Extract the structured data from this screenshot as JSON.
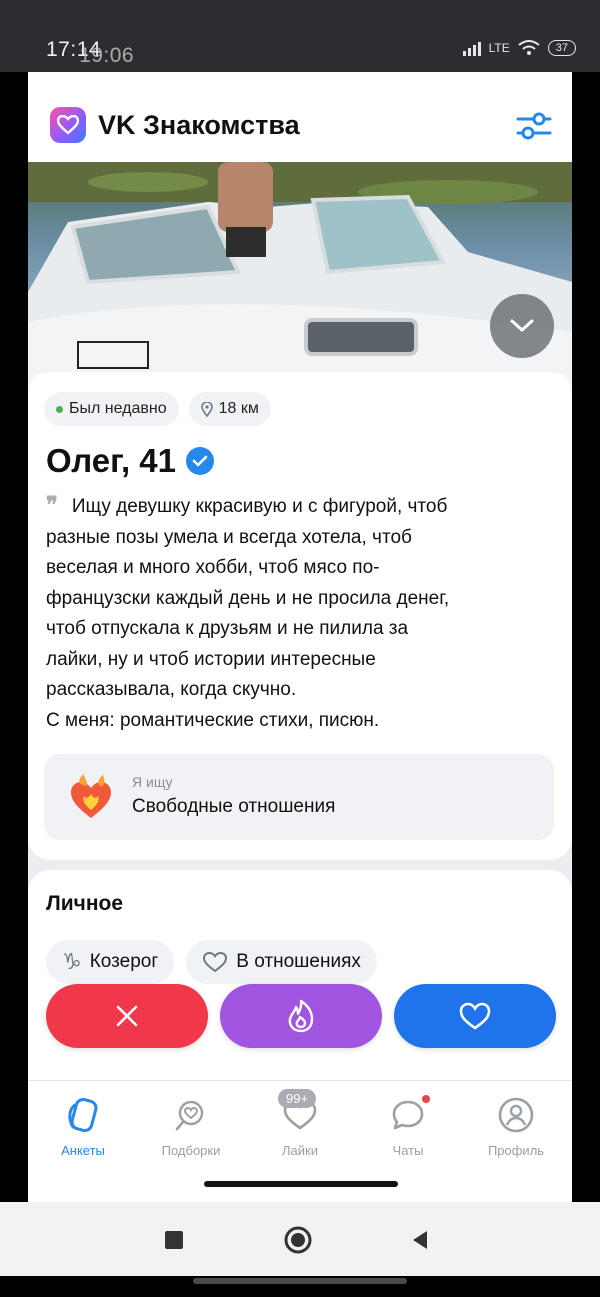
{
  "status_bar": {
    "time": "17:14",
    "time_ghost": "19:06",
    "network": "LTE",
    "battery": "37"
  },
  "header": {
    "app_title": "VK Знакомства",
    "icons": {
      "logo": "vk-heart-logo",
      "filter": "sliders-icon"
    }
  },
  "profile": {
    "status": "Был недавно",
    "distance": "18 км",
    "name_age": "Олег, 41",
    "bio_lines": [
      "Ищу девушку ккрасивую и с фигурой, чтоб",
      "разные позы умела и всегда хотела, чтоб",
      "веселая и много хобби, чтоб мясо по-",
      "французски каждый день и не просила денег,",
      "чтоб отпускала к друзьям и не пилила за",
      "лайки, ну и чтоб истории интересные",
      "рассказывала, когда скучно.",
      "С меня: романтические стихи, писюн."
    ],
    "looking_for_label": "Я ищу",
    "looking_for_value": "Свободные отношения"
  },
  "personal": {
    "title": "Личное",
    "tags": [
      {
        "icon": "capricorn-icon",
        "label": "Козерог"
      },
      {
        "icon": "heart-outline-icon",
        "label": "В отношениях"
      }
    ]
  },
  "actions": {
    "dislike": "close-icon",
    "super_like": "flame-icon",
    "like": "heart-icon"
  },
  "tabbar": {
    "tabs": [
      {
        "label": "Анкеты",
        "icon": "cards-icon",
        "active": true
      },
      {
        "label": "Подборки",
        "icon": "heart-search-icon"
      },
      {
        "label": "Лайки",
        "icon": "heart-icon",
        "badge": "99+"
      },
      {
        "label": "Чаты",
        "icon": "chat-icon",
        "dot": true
      },
      {
        "label": "Профиль",
        "icon": "profile-icon"
      }
    ]
  },
  "colors": {
    "accent": "#2688eb",
    "dislike": "#f0384a",
    "super": "#a154e0",
    "like": "#1f74ec"
  }
}
